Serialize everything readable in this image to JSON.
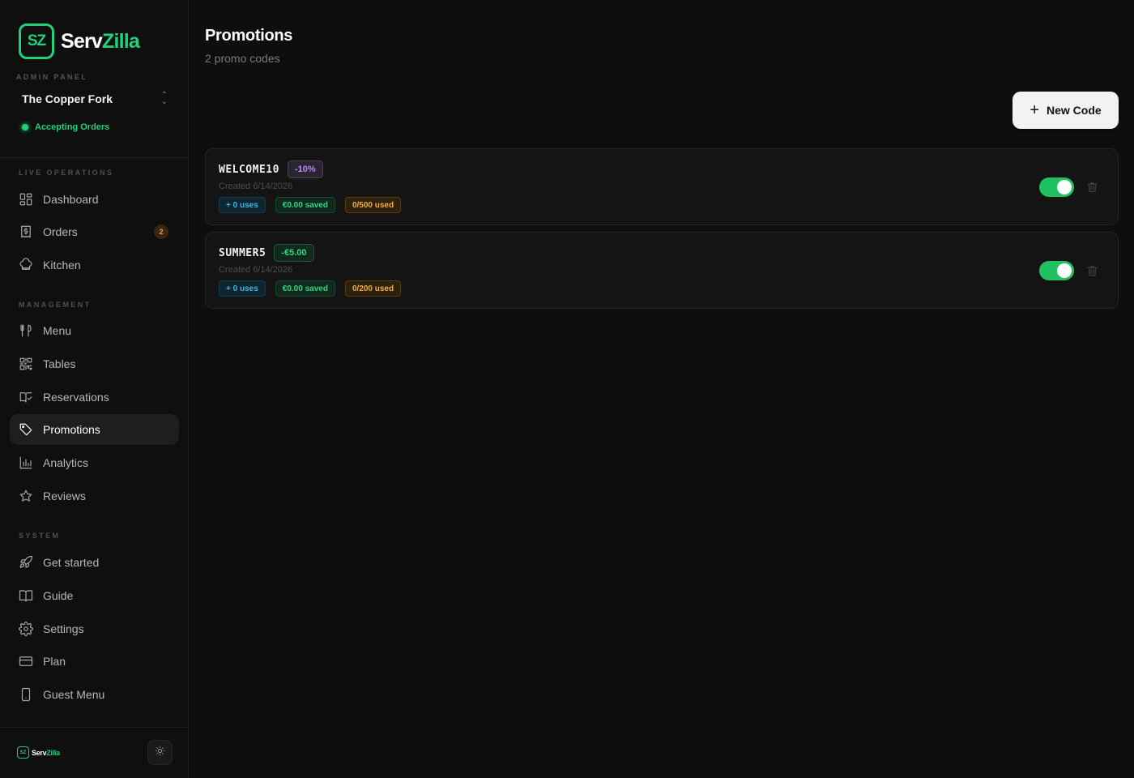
{
  "brand": {
    "logo_mark": "SZ",
    "name_part1": "Serv",
    "name_part2": "Zilla",
    "accent_color": "#1fd17a"
  },
  "sidebar": {
    "admin_label": "ADMIN PANEL",
    "restaurant_name": "The Copper Fork",
    "status_text": "Accepting Orders",
    "sections": {
      "live": "LIVE OPERATIONS",
      "management": "MANAGEMENT",
      "system": "SYSTEM"
    },
    "items": {
      "dashboard": "Dashboard",
      "orders": "Orders",
      "orders_count": "2",
      "kitchen": "Kitchen",
      "menu": "Menu",
      "tables": "Tables",
      "reservations": "Reservations",
      "promotions": "Promotions",
      "analytics": "Analytics",
      "reviews": "Reviews",
      "get_started": "Get started",
      "guide": "Guide",
      "settings": "Settings",
      "plan": "Plan",
      "guest_menu": "Guest Menu"
    },
    "active_item": "promotions",
    "footer_mark": "SZ",
    "footer_name_part1": "Serv",
    "footer_name_part2": "Zilla"
  },
  "header": {
    "title": "Promotions",
    "subtitle": "2 promo codes",
    "new_button": "New Code"
  },
  "promos": [
    {
      "code": "WELCOME10",
      "discount": "-10%",
      "created": "Created 6/14/2026",
      "uses": "+ 0 uses",
      "saved": "€0.00 saved",
      "used": "0/500 used",
      "active": true
    },
    {
      "code": "SUMMER5",
      "discount": "-€5.00",
      "created": "Created 6/14/2026",
      "uses": "+ 0 uses",
      "saved": "€0.00 saved",
      "used": "0/200 used",
      "active": true
    }
  ]
}
